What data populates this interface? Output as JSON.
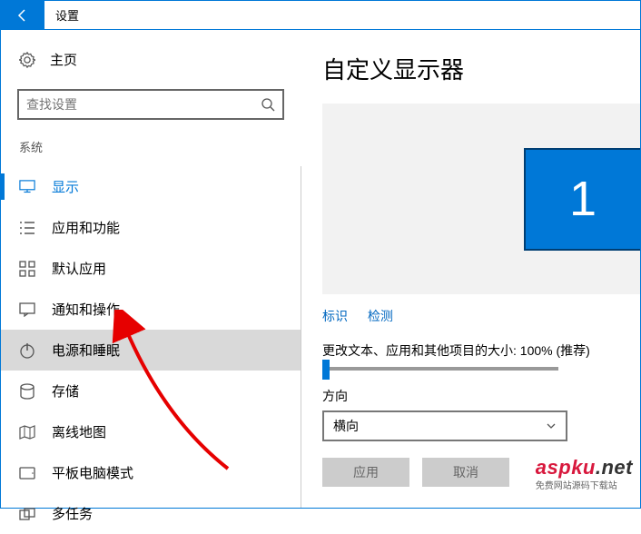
{
  "titlebar": {
    "title": "设置"
  },
  "sidebar": {
    "home": "主页",
    "search_placeholder": "查找设置",
    "category": "系统",
    "items": [
      {
        "label": "显示"
      },
      {
        "label": "应用和功能"
      },
      {
        "label": "默认应用"
      },
      {
        "label": "通知和操作"
      },
      {
        "label": "电源和睡眠"
      },
      {
        "label": "存储"
      },
      {
        "label": "离线地图"
      },
      {
        "label": "平板电脑模式"
      },
      {
        "label": "多任务"
      }
    ]
  },
  "content": {
    "title": "自定义显示器",
    "monitor_id": "1",
    "links": {
      "identify": "标识",
      "detect": "检测"
    },
    "scale_label": "更改文本、应用和其他项目的大小: 100% (推荐)",
    "orientation_label": "方向",
    "orientation_value": "横向",
    "buttons": {
      "apply": "应用",
      "cancel": "取消"
    }
  },
  "watermark": {
    "line1a": "aspku",
    "line1b": ".net",
    "line2": "免费网站源码下载站"
  }
}
